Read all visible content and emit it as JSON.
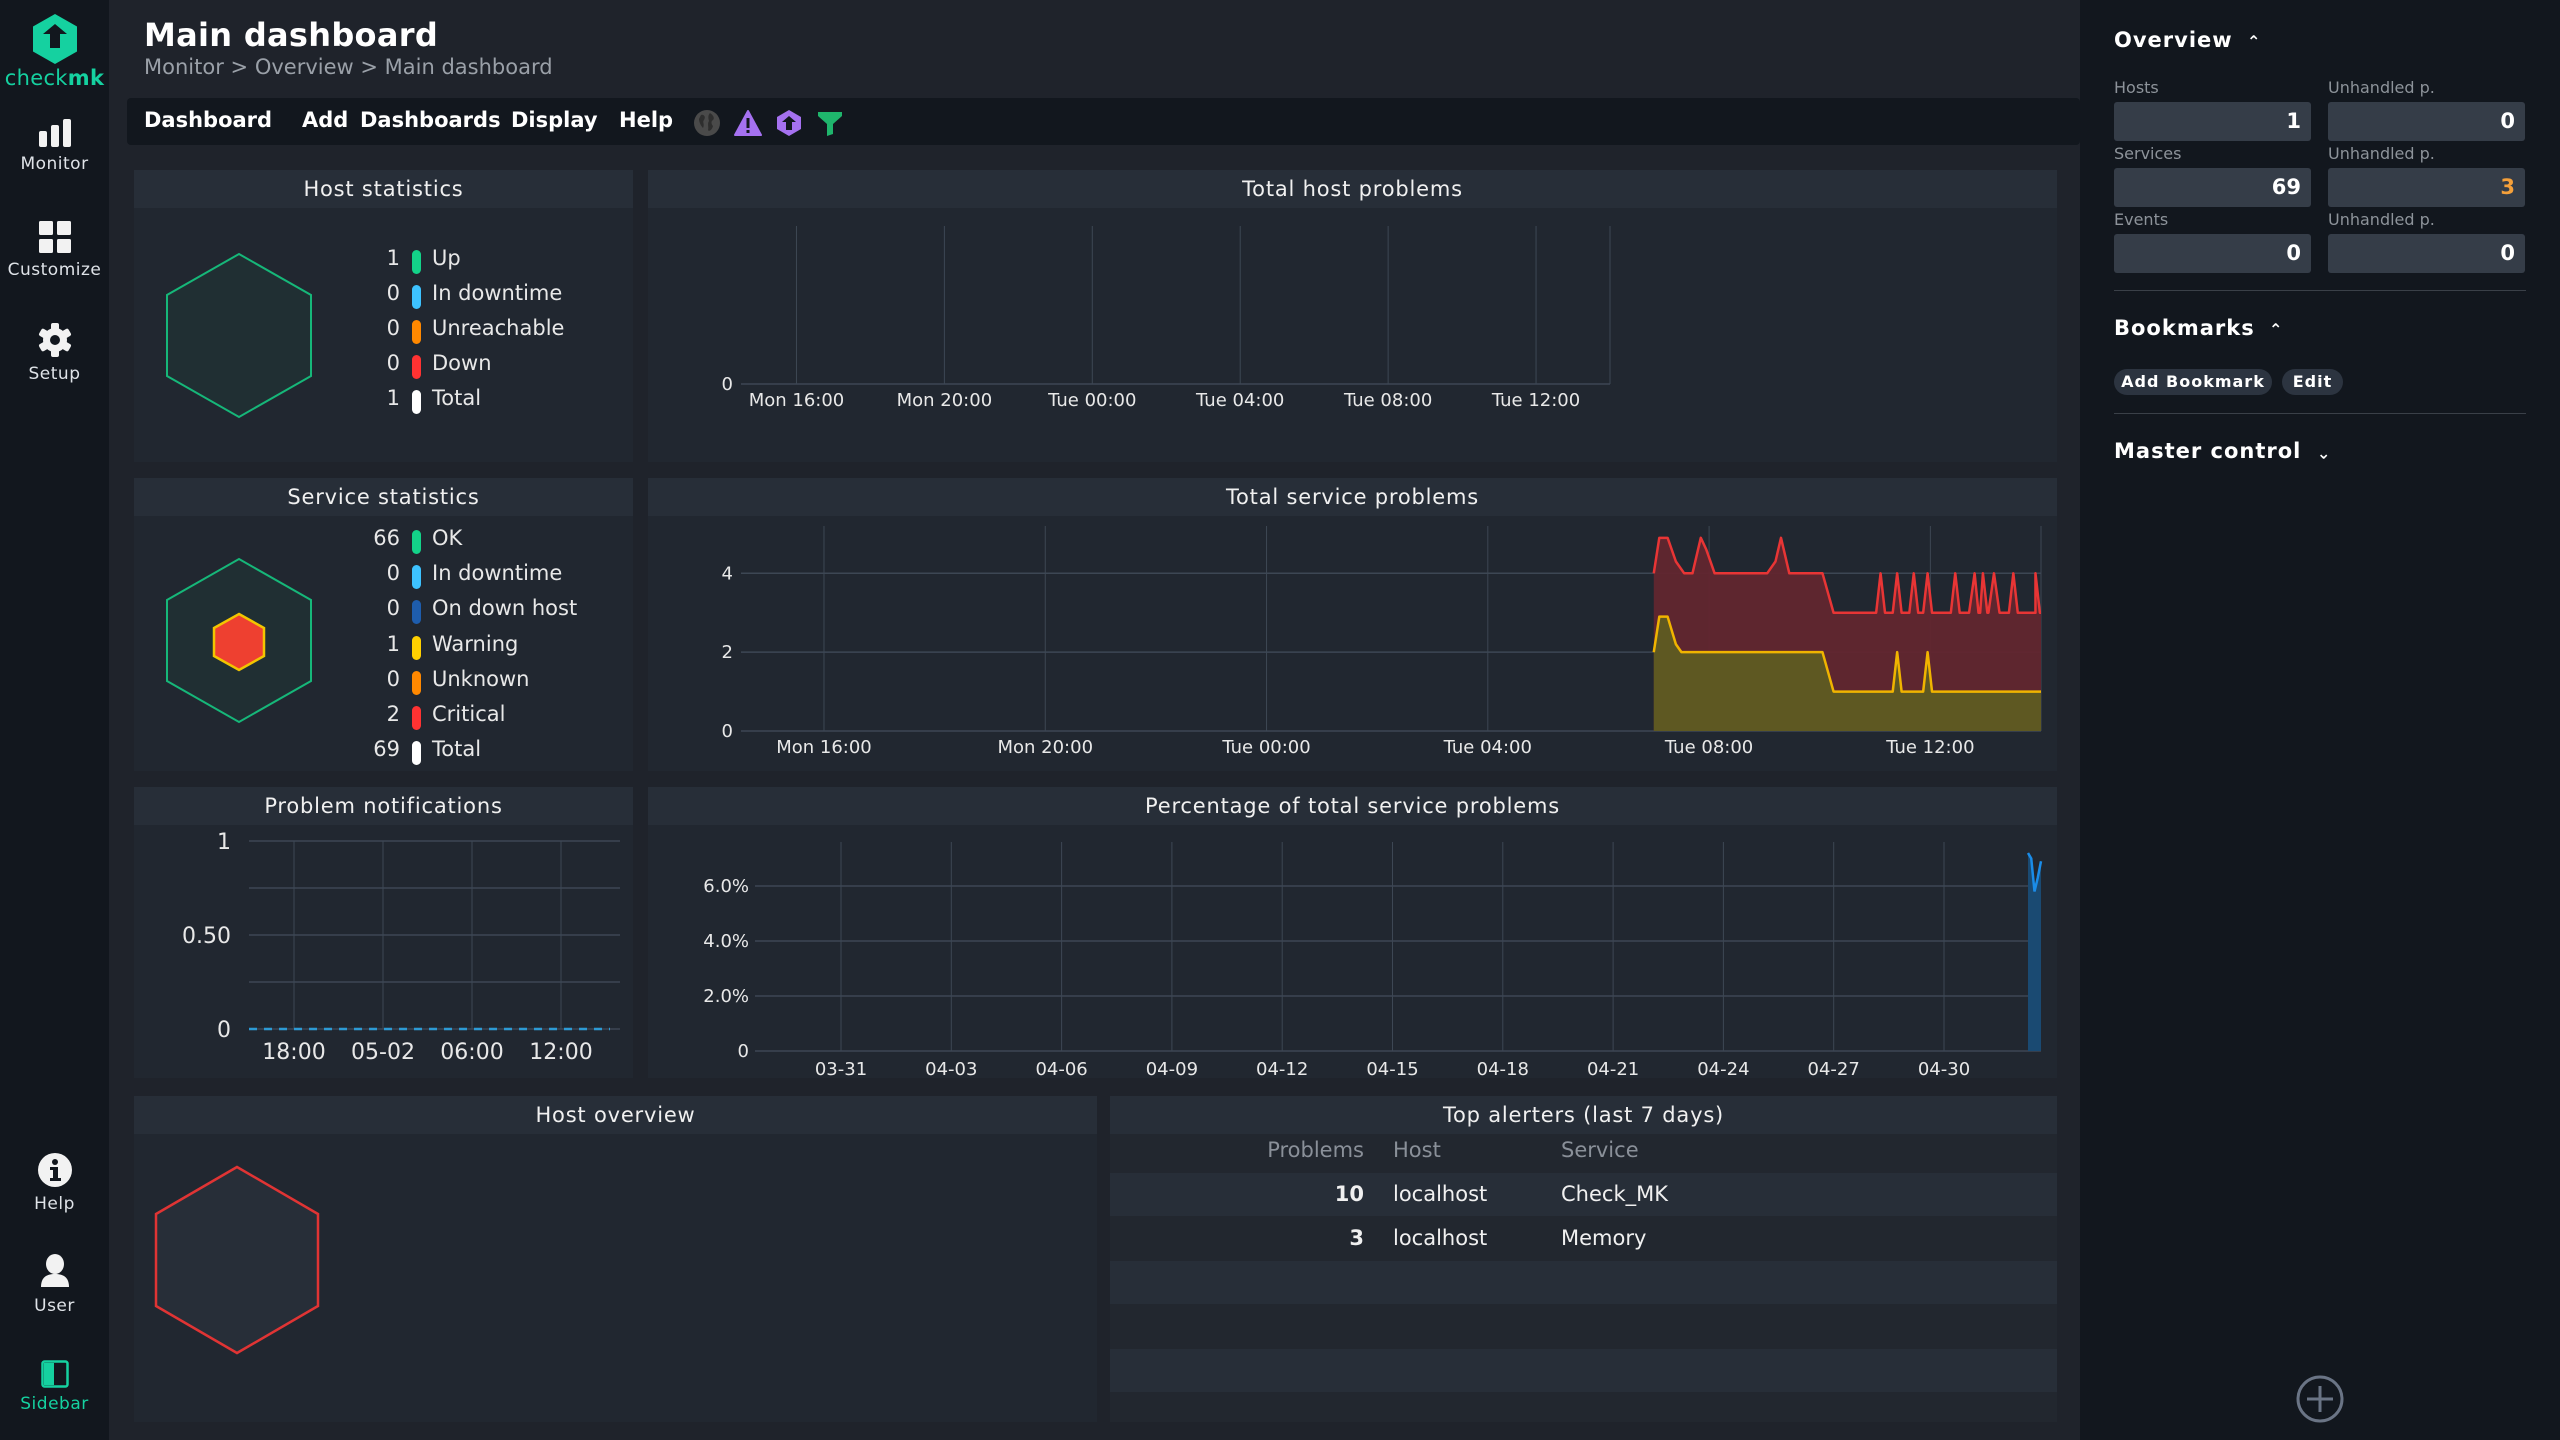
{
  "app": {
    "logo_text_light": "check",
    "logo_text_bold": "mk",
    "brand_color": "#15d1a0"
  },
  "leftnav": {
    "items": [
      {
        "label": "Monitor",
        "icon": "bar-chart-icon"
      },
      {
        "label": "Customize",
        "icon": "grid-icon"
      },
      {
        "label": "Setup",
        "icon": "gear-icon"
      }
    ],
    "bottom_items": [
      {
        "label": "Help",
        "icon": "info-icon"
      },
      {
        "label": "User",
        "icon": "user-icon"
      },
      {
        "label": "Sidebar",
        "icon": "sidebar-icon"
      }
    ]
  },
  "header": {
    "title": "Main dashboard",
    "breadcrumb": [
      "Monitor",
      "Overview",
      "Main dashboard"
    ],
    "separator": ">"
  },
  "menubar": {
    "items": [
      "Dashboard",
      "Add",
      "Dashboards",
      "Display",
      "Help"
    ],
    "icons": [
      "globe-icon",
      "warning-icon",
      "checkmk-purple-icon",
      "filter-icon"
    ]
  },
  "host_statistics": {
    "title": "Host statistics",
    "rows": [
      {
        "count": "1",
        "label": "Up",
        "color": "#13d389"
      },
      {
        "count": "0",
        "label": "In downtime",
        "color": "#3dc2ff"
      },
      {
        "count": "0",
        "label": "Unreachable",
        "color": "#ff8800"
      },
      {
        "count": "0",
        "label": "Down",
        "color": "#ff3232"
      },
      {
        "count": "1",
        "label": "Total",
        "color": "#ffffff"
      }
    ]
  },
  "service_statistics": {
    "title": "Service statistics",
    "rows": [
      {
        "count": "66",
        "label": "OK",
        "color": "#13d389"
      },
      {
        "count": "0",
        "label": "In downtime",
        "color": "#3dc2ff"
      },
      {
        "count": "0",
        "label": "On down host",
        "color": "#1e5dad"
      },
      {
        "count": "1",
        "label": "Warning",
        "color": "#ffd000"
      },
      {
        "count": "0",
        "label": "Unknown",
        "color": "#ff8800"
      },
      {
        "count": "2",
        "label": "Critical",
        "color": "#ff3232"
      },
      {
        "count": "69",
        "label": "Total",
        "color": "#ffffff"
      }
    ]
  },
  "host_overview": {
    "title": "Host overview"
  },
  "top_alerters": {
    "title": "Top alerters (last 7 days)",
    "columns": [
      "Problems",
      "Host",
      "Service"
    ],
    "rows": [
      {
        "problems": "10",
        "host": "localhost",
        "service": "Check_MK"
      },
      {
        "problems": "3",
        "host": "localhost",
        "service": "Memory"
      }
    ]
  },
  "chart_data": [
    {
      "id": "total_host_problems",
      "type": "area",
      "title": "Total host problems",
      "xlabel": "",
      "ylabel": "",
      "x_ticks": [
        "Mon 16:00",
        "Mon 20:00",
        "Tue 00:00",
        "Tue 04:00",
        "Tue 08:00",
        "Tue 12:00"
      ],
      "y_ticks": [
        "0"
      ],
      "ylim": [
        0,
        1
      ],
      "grid": true,
      "series": []
    },
    {
      "id": "total_service_problems",
      "type": "area",
      "title": "Total service problems",
      "x_ticks": [
        "Mon 16:00",
        "Mon 20:00",
        "Tue 00:00",
        "Tue 04:00",
        "Tue 08:00",
        "Tue 12:00"
      ],
      "x_hours_range": [
        14.5,
        38.0
      ],
      "y_ticks": [
        "0",
        "2",
        "4"
      ],
      "ylim": [
        0,
        5.2
      ],
      "grid": true,
      "series": [
        {
          "name": "Critical (stacked total)",
          "color": "#e83535",
          "fill": "#62262f",
          "points": [
            [
              31.0,
              4
            ],
            [
              31.1,
              4.9
            ],
            [
              31.25,
              4.9
            ],
            [
              31.4,
              4.3
            ],
            [
              31.55,
              4
            ],
            [
              31.7,
              4
            ],
            [
              31.85,
              4.9
            ],
            [
              31.95,
              4.6
            ],
            [
              32.1,
              4
            ],
            [
              33.05,
              4
            ],
            [
              33.2,
              4.3
            ],
            [
              33.3,
              4.9
            ],
            [
              33.45,
              4
            ],
            [
              34.05,
              4
            ],
            [
              34.25,
              3
            ],
            [
              34.4,
              3
            ],
            [
              36.7,
              3
            ],
            [
              36.8,
              4
            ],
            [
              36.9,
              3
            ],
            [
              37.05,
              3
            ],
            [
              37.15,
              4
            ],
            [
              37.25,
              3
            ],
            [
              37.4,
              3
            ],
            [
              37.5,
              4
            ],
            [
              37.6,
              3
            ],
            [
              37.9,
              3
            ]
          ],
          "extra_spikes_hours": [
            35.1,
            35.4,
            35.7,
            35.95,
            36.45,
            36.95,
            37.5,
            37.9,
            38.2,
            38.5,
            38.85
          ]
        },
        {
          "name": "Warning",
          "color": "#f0b400",
          "fill": "#5e5b22",
          "points": [
            [
              31.0,
              2
            ],
            [
              31.1,
              2.9
            ],
            [
              31.25,
              2.9
            ],
            [
              31.4,
              2.2
            ],
            [
              31.5,
              2
            ],
            [
              34.05,
              2
            ],
            [
              34.25,
              1
            ],
            [
              34.4,
              1
            ],
            [
              38.0,
              1
            ]
          ],
          "extra_spikes_hours": [
            35.4,
            35.95,
            38.85
          ]
        }
      ]
    },
    {
      "id": "problem_notifications",
      "type": "line",
      "title": "Problem notifications",
      "x_ticks": [
        "18:00",
        "05-02",
        "06:00",
        "12:00"
      ],
      "y_ticks": [
        "0",
        "0.50",
        "1"
      ],
      "ylim": [
        0,
        1
      ],
      "grid": true,
      "series": [
        {
          "name": "Notifications",
          "color": "#2d9ad4",
          "style": "dashed",
          "values": [
            0,
            0,
            0,
            0,
            0
          ]
        }
      ]
    },
    {
      "id": "percentage_service_problems",
      "type": "area",
      "title": "Percentage of total service problems",
      "x_ticks": [
        "03-31",
        "04-03",
        "04-06",
        "04-09",
        "04-12",
        "04-15",
        "04-18",
        "04-21",
        "04-24",
        "04-27",
        "04-30"
      ],
      "y_ticks": [
        "0",
        "2.0%",
        "4.0%",
        "6.0%"
      ],
      "ylim": [
        0,
        7.6
      ],
      "grid": true,
      "series": [
        {
          "name": "Percentage",
          "color": "#1a8ce8",
          "fill": "#1a4a72",
          "values_pct": [
            7.2,
            7.0,
            5.8,
            6.3,
            6.9
          ]
        }
      ]
    }
  ],
  "rightbar": {
    "overview": {
      "title": "Overview",
      "rows": [
        {
          "label": "Hosts",
          "value": "1",
          "unhandled_label": "Unhandled p.",
          "unhandled": "0",
          "unhandled_color": "#ffffff"
        },
        {
          "label": "Services",
          "value": "69",
          "unhandled_label": "Unhandled p.",
          "unhandled": "3",
          "unhandled_color": "#f5a03a"
        },
        {
          "label": "Events",
          "value": "0",
          "unhandled_label": "Unhandled p.",
          "unhandled": "0",
          "unhandled_color": "#ffffff"
        }
      ]
    },
    "bookmarks": {
      "title": "Bookmarks",
      "add_label": "Add Bookmark",
      "edit_label": "Edit"
    },
    "master_control": {
      "title": "Master control"
    },
    "add_snapin_icon": "plus-circle-icon"
  }
}
